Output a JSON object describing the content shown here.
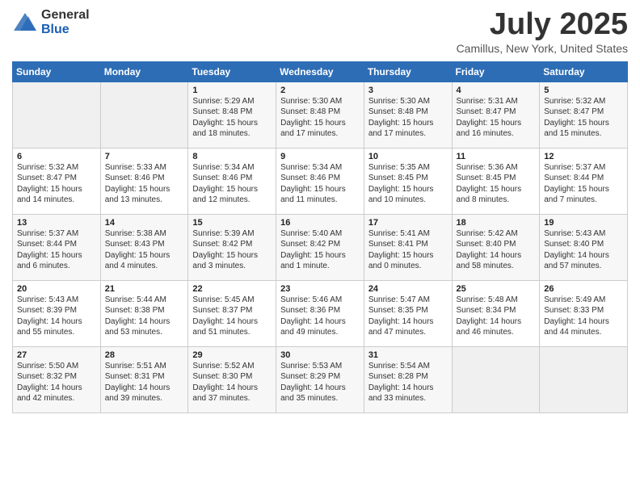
{
  "header": {
    "logo_general": "General",
    "logo_blue": "Blue",
    "month_title": "July 2025",
    "location": "Camillus, New York, United States"
  },
  "weekdays": [
    "Sunday",
    "Monday",
    "Tuesday",
    "Wednesday",
    "Thursday",
    "Friday",
    "Saturday"
  ],
  "weeks": [
    [
      {
        "day": "",
        "empty": true
      },
      {
        "day": "",
        "empty": true
      },
      {
        "day": "1",
        "sunrise": "Sunrise: 5:29 AM",
        "sunset": "Sunset: 8:48 PM",
        "daylight": "Daylight: 15 hours and 18 minutes."
      },
      {
        "day": "2",
        "sunrise": "Sunrise: 5:30 AM",
        "sunset": "Sunset: 8:48 PM",
        "daylight": "Daylight: 15 hours and 17 minutes."
      },
      {
        "day": "3",
        "sunrise": "Sunrise: 5:30 AM",
        "sunset": "Sunset: 8:48 PM",
        "daylight": "Daylight: 15 hours and 17 minutes."
      },
      {
        "day": "4",
        "sunrise": "Sunrise: 5:31 AM",
        "sunset": "Sunset: 8:47 PM",
        "daylight": "Daylight: 15 hours and 16 minutes."
      },
      {
        "day": "5",
        "sunrise": "Sunrise: 5:32 AM",
        "sunset": "Sunset: 8:47 PM",
        "daylight": "Daylight: 15 hours and 15 minutes."
      }
    ],
    [
      {
        "day": "6",
        "sunrise": "Sunrise: 5:32 AM",
        "sunset": "Sunset: 8:47 PM",
        "daylight": "Daylight: 15 hours and 14 minutes."
      },
      {
        "day": "7",
        "sunrise": "Sunrise: 5:33 AM",
        "sunset": "Sunset: 8:46 PM",
        "daylight": "Daylight: 15 hours and 13 minutes."
      },
      {
        "day": "8",
        "sunrise": "Sunrise: 5:34 AM",
        "sunset": "Sunset: 8:46 PM",
        "daylight": "Daylight: 15 hours and 12 minutes."
      },
      {
        "day": "9",
        "sunrise": "Sunrise: 5:34 AM",
        "sunset": "Sunset: 8:46 PM",
        "daylight": "Daylight: 15 hours and 11 minutes."
      },
      {
        "day": "10",
        "sunrise": "Sunrise: 5:35 AM",
        "sunset": "Sunset: 8:45 PM",
        "daylight": "Daylight: 15 hours and 10 minutes."
      },
      {
        "day": "11",
        "sunrise": "Sunrise: 5:36 AM",
        "sunset": "Sunset: 8:45 PM",
        "daylight": "Daylight: 15 hours and 8 minutes."
      },
      {
        "day": "12",
        "sunrise": "Sunrise: 5:37 AM",
        "sunset": "Sunset: 8:44 PM",
        "daylight": "Daylight: 15 hours and 7 minutes."
      }
    ],
    [
      {
        "day": "13",
        "sunrise": "Sunrise: 5:37 AM",
        "sunset": "Sunset: 8:44 PM",
        "daylight": "Daylight: 15 hours and 6 minutes."
      },
      {
        "day": "14",
        "sunrise": "Sunrise: 5:38 AM",
        "sunset": "Sunset: 8:43 PM",
        "daylight": "Daylight: 15 hours and 4 minutes."
      },
      {
        "day": "15",
        "sunrise": "Sunrise: 5:39 AM",
        "sunset": "Sunset: 8:42 PM",
        "daylight": "Daylight: 15 hours and 3 minutes."
      },
      {
        "day": "16",
        "sunrise": "Sunrise: 5:40 AM",
        "sunset": "Sunset: 8:42 PM",
        "daylight": "Daylight: 15 hours and 1 minute."
      },
      {
        "day": "17",
        "sunrise": "Sunrise: 5:41 AM",
        "sunset": "Sunset: 8:41 PM",
        "daylight": "Daylight: 15 hours and 0 minutes."
      },
      {
        "day": "18",
        "sunrise": "Sunrise: 5:42 AM",
        "sunset": "Sunset: 8:40 PM",
        "daylight": "Daylight: 14 hours and 58 minutes."
      },
      {
        "day": "19",
        "sunrise": "Sunrise: 5:43 AM",
        "sunset": "Sunset: 8:40 PM",
        "daylight": "Daylight: 14 hours and 57 minutes."
      }
    ],
    [
      {
        "day": "20",
        "sunrise": "Sunrise: 5:43 AM",
        "sunset": "Sunset: 8:39 PM",
        "daylight": "Daylight: 14 hours and 55 minutes."
      },
      {
        "day": "21",
        "sunrise": "Sunrise: 5:44 AM",
        "sunset": "Sunset: 8:38 PM",
        "daylight": "Daylight: 14 hours and 53 minutes."
      },
      {
        "day": "22",
        "sunrise": "Sunrise: 5:45 AM",
        "sunset": "Sunset: 8:37 PM",
        "daylight": "Daylight: 14 hours and 51 minutes."
      },
      {
        "day": "23",
        "sunrise": "Sunrise: 5:46 AM",
        "sunset": "Sunset: 8:36 PM",
        "daylight": "Daylight: 14 hours and 49 minutes."
      },
      {
        "day": "24",
        "sunrise": "Sunrise: 5:47 AM",
        "sunset": "Sunset: 8:35 PM",
        "daylight": "Daylight: 14 hours and 47 minutes."
      },
      {
        "day": "25",
        "sunrise": "Sunrise: 5:48 AM",
        "sunset": "Sunset: 8:34 PM",
        "daylight": "Daylight: 14 hours and 46 minutes."
      },
      {
        "day": "26",
        "sunrise": "Sunrise: 5:49 AM",
        "sunset": "Sunset: 8:33 PM",
        "daylight": "Daylight: 14 hours and 44 minutes."
      }
    ],
    [
      {
        "day": "27",
        "sunrise": "Sunrise: 5:50 AM",
        "sunset": "Sunset: 8:32 PM",
        "daylight": "Daylight: 14 hours and 42 minutes."
      },
      {
        "day": "28",
        "sunrise": "Sunrise: 5:51 AM",
        "sunset": "Sunset: 8:31 PM",
        "daylight": "Daylight: 14 hours and 39 minutes."
      },
      {
        "day": "29",
        "sunrise": "Sunrise: 5:52 AM",
        "sunset": "Sunset: 8:30 PM",
        "daylight": "Daylight: 14 hours and 37 minutes."
      },
      {
        "day": "30",
        "sunrise": "Sunrise: 5:53 AM",
        "sunset": "Sunset: 8:29 PM",
        "daylight": "Daylight: 14 hours and 35 minutes."
      },
      {
        "day": "31",
        "sunrise": "Sunrise: 5:54 AM",
        "sunset": "Sunset: 8:28 PM",
        "daylight": "Daylight: 14 hours and 33 minutes."
      },
      {
        "day": "",
        "empty": true
      },
      {
        "day": "",
        "empty": true
      }
    ]
  ]
}
